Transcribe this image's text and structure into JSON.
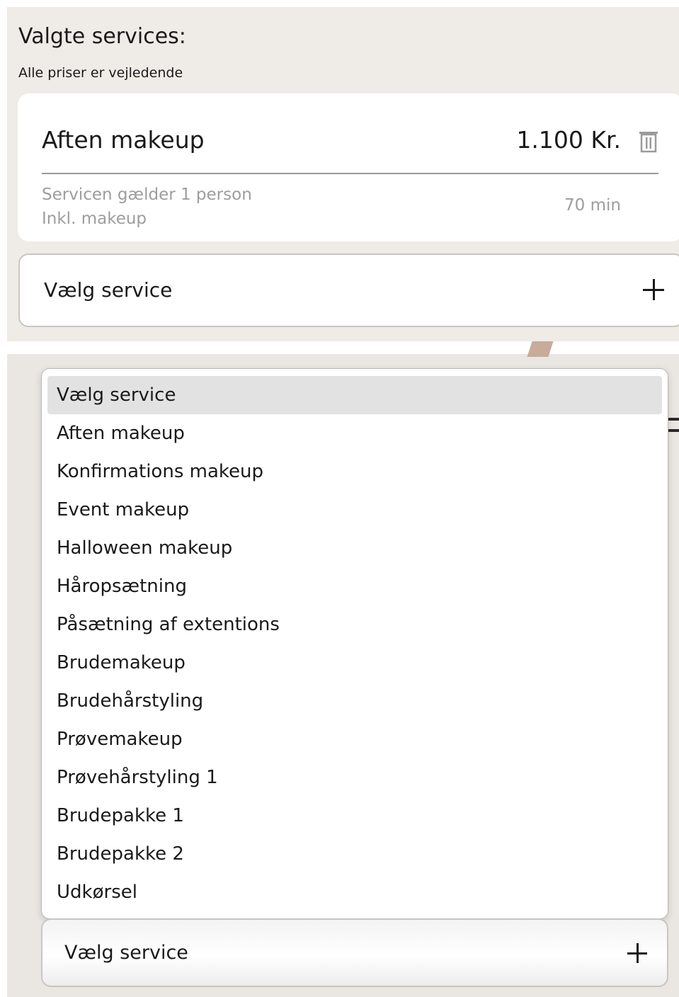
{
  "selected_services": {
    "title": "Valgte services:",
    "subtitle": "Alle priser er vejledende",
    "item": {
      "name": "Aften makeup",
      "price": "1.100 Kr.",
      "description_line1": "Servicen gælder 1 person",
      "description_line2": "Inkl. makeup",
      "duration": "70 min",
      "delete_icon": "trash-icon"
    },
    "select": {
      "label": "Vælg service",
      "icon": "plus-icon"
    }
  },
  "dropdown": {
    "selected_index": 0,
    "options": [
      "Vælg service",
      "Aften makeup",
      "Konfirmations makeup",
      "Event makeup",
      "Halloween makeup",
      "Håropsætning",
      "Påsætning af extentions",
      "Brudemakeup",
      "Brudehårstyling",
      "Prøvemakeup",
      "Prøvehårstyling 1",
      "Brudepakke 1",
      "Brudepakke 2",
      "Udkørsel"
    ]
  },
  "bottom_select": {
    "label": "Vælg service",
    "icon": "plus-icon"
  },
  "colors": {
    "panel_bg": "#efebe7",
    "muted_text": "#9d9d9d",
    "option_highlight": "#e2e2e2"
  }
}
